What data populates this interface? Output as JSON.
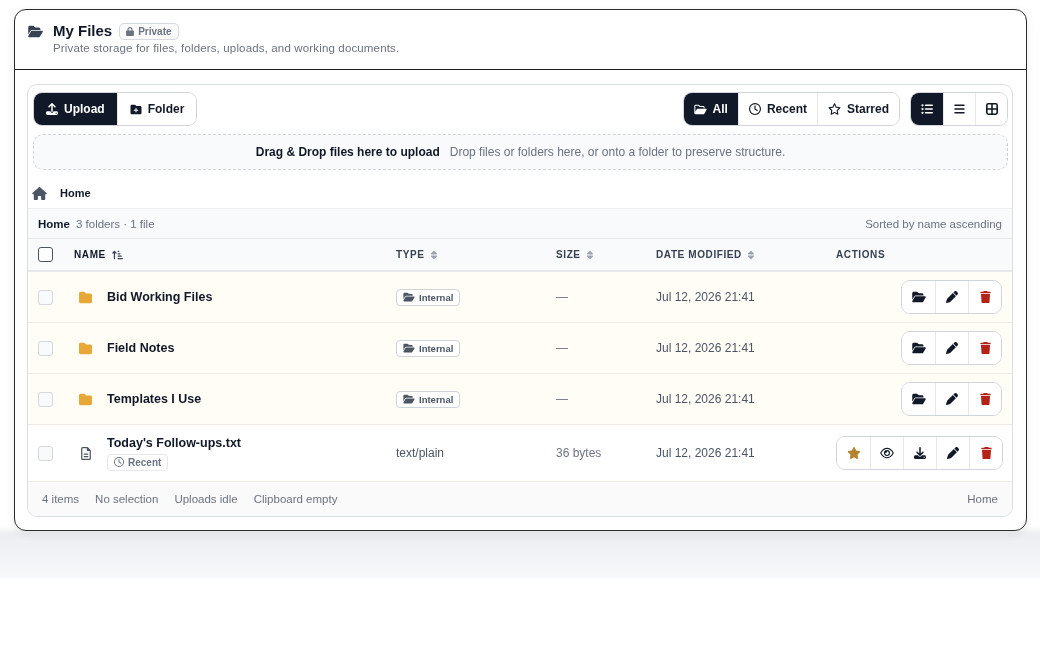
{
  "header": {
    "title": "My Files",
    "badge": "Private",
    "subtitle": "Private storage for files, folders, uploads, and working documents."
  },
  "toolbar": {
    "actions": [
      {
        "kind": "upload",
        "label": "Upload",
        "primary": true
      },
      {
        "kind": "folder",
        "label": "Folder",
        "primary": false
      }
    ],
    "filters": [
      {
        "kind": "all",
        "label": "All",
        "selected": true
      },
      {
        "kind": "recent",
        "label": "Recent",
        "selected": false
      },
      {
        "kind": "starred",
        "label": "Starred",
        "selected": false
      }
    ],
    "views": [
      {
        "kind": "details",
        "selected": true
      },
      {
        "kind": "list",
        "selected": false
      },
      {
        "kind": "grid",
        "selected": false
      }
    ]
  },
  "dropzone": {
    "title": "Drag & Drop files here to upload",
    "hint": "Drop files or folders here, or onto a folder to preserve structure."
  },
  "breadcrumb": [
    "Home"
  ],
  "summary": {
    "location": "Home",
    "counts": "3 folders · 1 file",
    "sort_note": "Sorted by name ascending"
  },
  "table": {
    "select_all": {
      "checked": false
    },
    "columns": [
      {
        "label": "NAME",
        "sortable": true,
        "sorted": true
      },
      {
        "label": "TYPE",
        "sortable": true,
        "sorted": false
      },
      {
        "label": "SIZE",
        "sortable": true,
        "sorted": false
      },
      {
        "label": "DATE MODIFIED",
        "sortable": true,
        "sorted": false
      },
      {
        "label": "ACTIONS",
        "sortable": false,
        "sorted": false
      }
    ],
    "rows": [
      {
        "kind": "folder",
        "checked": false,
        "name": "Bid Working Files",
        "type": "Internal",
        "size": "—",
        "modified": "Jul 12, 2026 21:41"
      },
      {
        "kind": "folder",
        "checked": false,
        "name": "Field Notes",
        "type": "Internal",
        "size": "—",
        "modified": "Jul 12, 2026 21:41"
      },
      {
        "kind": "folder",
        "checked": false,
        "name": "Templates I Use",
        "type": "Internal",
        "size": "—",
        "modified": "Jul 12, 2026 21:41"
      },
      {
        "kind": "file",
        "checked": false,
        "name": "Today's Follow-ups.txt",
        "badge": "Recent",
        "type": "text/plain",
        "size": "36 bytes",
        "modified": "Jul 12, 2026 21:41",
        "starred": true
      }
    ]
  },
  "status_bar": {
    "items": [
      "4 items",
      "No selection",
      "Uploads idle",
      "Clipboard empty"
    ],
    "location": "Home"
  }
}
